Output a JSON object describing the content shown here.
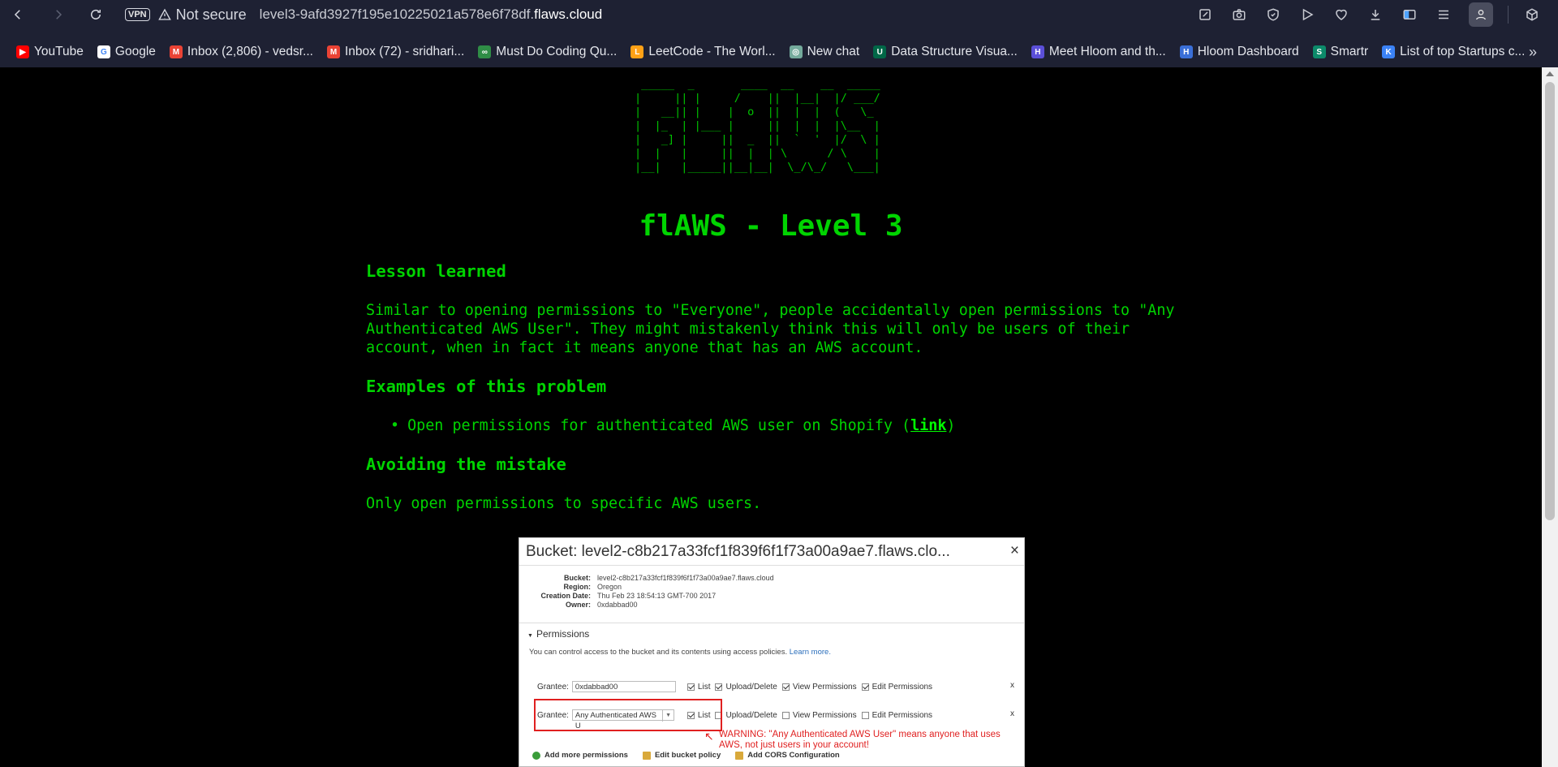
{
  "browser": {
    "vpn_label": "VPN",
    "security_label": "Not secure",
    "url_prefix": "level3-9afd3927f195e10225021a578e6f78df.",
    "url_domain": "flaws.cloud"
  },
  "bookmarks": [
    {
      "label": "YouTube",
      "icon": "youtube-icon",
      "color": "#ff0000",
      "glyph": "▶"
    },
    {
      "label": "Google",
      "icon": "google-icon",
      "color": "#ffffff",
      "glyph": "G"
    },
    {
      "label": "Inbox (2,806) - vedsr...",
      "icon": "gmail-icon",
      "color": "#ea4335",
      "glyph": "M"
    },
    {
      "label": "Inbox (72) - sridhari...",
      "icon": "gmail-icon",
      "color": "#ea4335",
      "glyph": "M"
    },
    {
      "label": "Must Do Coding Qu...",
      "icon": "gfg-icon",
      "color": "#2f8d46",
      "glyph": "∞"
    },
    {
      "label": "LeetCode - The Worl...",
      "icon": "leetcode-icon",
      "color": "#ffa116",
      "glyph": "L"
    },
    {
      "label": "New chat",
      "icon": "chatgpt-icon",
      "color": "#74aa9c",
      "glyph": "◎"
    },
    {
      "label": "Data Structure Visua...",
      "icon": "usf-icon",
      "color": "#006747",
      "glyph": "U"
    },
    {
      "label": "Meet Hloom and th...",
      "icon": "hloom-icon",
      "color": "#5b4fd8",
      "glyph": "H"
    },
    {
      "label": "Hloom Dashboard",
      "icon": "hloom-dashboard-icon",
      "color": "#3a6fd8",
      "glyph": "H"
    },
    {
      "label": "Smartr",
      "icon": "smartr-icon",
      "color": "#0c8a6a",
      "glyph": "S"
    },
    {
      "label": "List of top Startups c...",
      "icon": "startups-icon",
      "color": "#3b82f6",
      "glyph": "K"
    }
  ],
  "page": {
    "ascii_logo": " _____  _       ____  __    __  _____\n|     || |     /    ||  |__|  |/ ___/\n|   __|| |    |  o  ||  |  |  (   \\_ \n|  |_  | |___ |     ||  |  |  |\\__  |\n|   _] |     ||  _  ||  `  '  |/  \\ |\n|  |   |     ||  |  | \\      / \\    |\n|__|   |_____||__|__|  \\_/\\_/   \\___|",
    "title": "flAWS - Level 3",
    "lesson_heading": "Lesson learned",
    "lesson_text": "Similar to opening permissions to \"Everyone\", people accidentally open permissions to \"Any Authenticated AWS User\". They might mistakenly think this will only be users of their account, when in fact it means anyone that has an AWS account.",
    "examples_heading": "Examples of this problem",
    "example_item_text": "Open permissions for authenticated AWS user on Shopify (",
    "example_link": "link",
    "example_item_close": ")",
    "avoid_heading": "Avoiding the mistake",
    "avoid_text": "Only open permissions to specific AWS users."
  },
  "screenshot": {
    "title": "Bucket: level2-c8b217a33fcf1f839f6f1f73a00a9ae7.flaws.clo...",
    "close": "×",
    "props": [
      {
        "k": "Bucket:",
        "v": "level2-c8b217a33fcf1f839f6f1f73a00a9ae7.flaws.cloud"
      },
      {
        "k": "Region:",
        "v": "Oregon"
      },
      {
        "k": "Creation Date:",
        "v": "Thu Feb 23 18:54:13 GMT-700 2017"
      },
      {
        "k": "Owner:",
        "v": "0xdabbad00"
      }
    ],
    "permissions_heading": "Permissions",
    "permissions_desc": "You can control access to the bucket and its contents using access policies.",
    "learn_more": "Learn more.",
    "grantee_label": "Grantee:",
    "row1_grantee": "0xdabbad00",
    "row2_grantee": "Any Authenticated AWS U",
    "perm_list": "List",
    "perm_upload": "Upload/Delete",
    "perm_view": "View Permissions",
    "perm_edit": "Edit Permissions",
    "remove": "x",
    "warning": "WARNING: \"Any Authenticated AWS User\" means anyone that uses AWS, not just users in your account!",
    "add_perms": "Add more permissions",
    "edit_policy": "Edit bucket policy",
    "add_cors": "Add CORS Configuration"
  }
}
